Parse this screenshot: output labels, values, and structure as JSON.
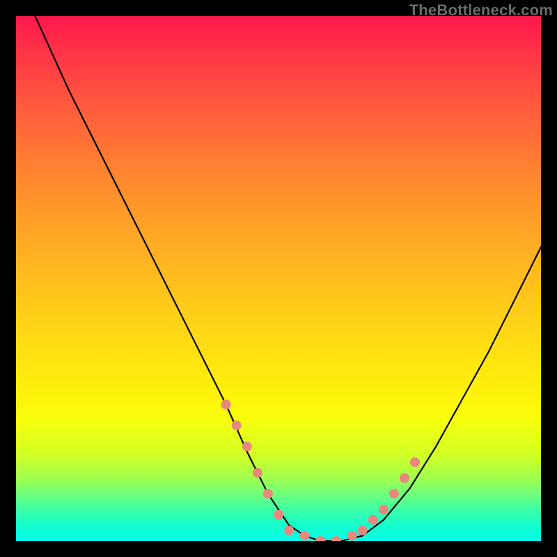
{
  "attribution": "TheBottleneck.com",
  "chart_data": {
    "type": "line",
    "title": "",
    "xlabel": "",
    "ylabel": "",
    "xlim": [
      0,
      100
    ],
    "ylim": [
      0,
      100
    ],
    "series": [
      {
        "name": "curve",
        "x": [
          0,
          5,
          10,
          15,
          20,
          25,
          30,
          35,
          40,
          44,
          48,
          52,
          55,
          58,
          62,
          66,
          70,
          75,
          80,
          85,
          90,
          95,
          100
        ],
        "y": [
          108,
          97,
          86,
          76,
          66,
          56,
          46,
          36,
          26,
          17,
          9,
          3,
          1,
          0,
          0,
          1,
          4,
          10,
          18,
          27,
          36,
          46,
          56
        ]
      }
    ],
    "highlight_points": {
      "x": [
        40,
        42,
        44,
        46,
        48,
        50,
        52,
        55,
        58,
        61,
        64,
        66,
        68,
        70,
        72,
        74,
        76
      ],
      "y": [
        26,
        22,
        18,
        13,
        9,
        5,
        2,
        1,
        0,
        0,
        1,
        2,
        4,
        6,
        9,
        12,
        15
      ]
    },
    "background_gradient": {
      "top": "#ff1749",
      "mid": "#ffd018",
      "bottom": "#00ffe7"
    }
  }
}
